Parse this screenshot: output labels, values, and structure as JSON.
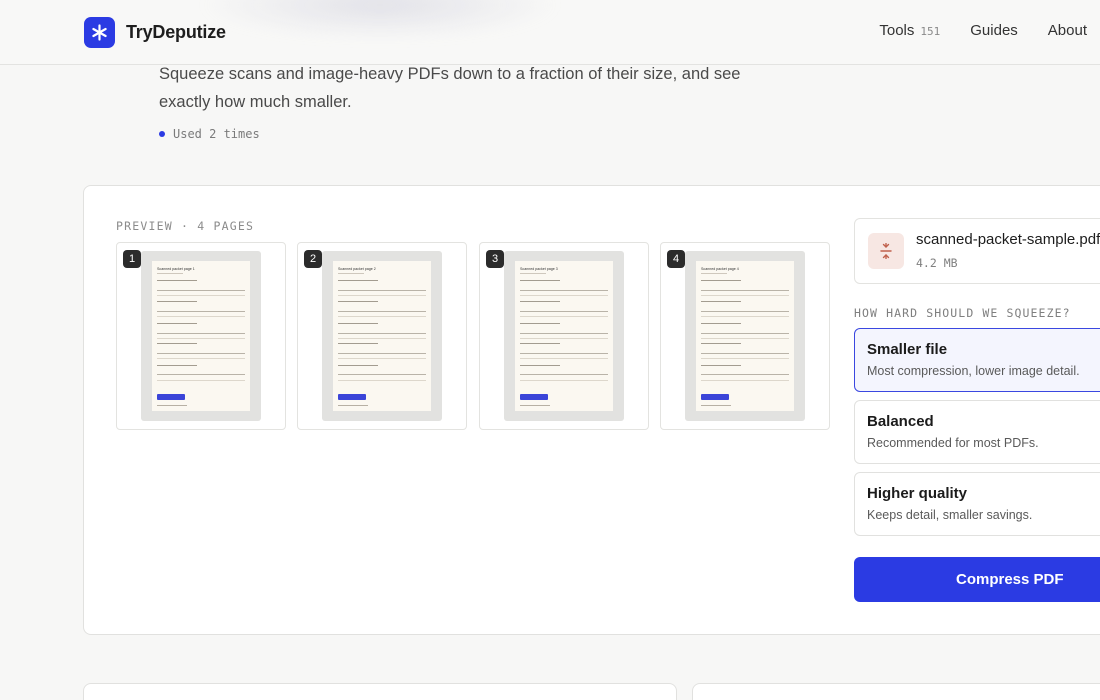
{
  "header": {
    "brand": "TryDeputize",
    "nav": [
      {
        "label": "Tools",
        "count": "151"
      },
      {
        "label": "Guides"
      },
      {
        "label": "About"
      }
    ]
  },
  "intro": {
    "description": "Squeeze scans and image-heavy PDFs down to a fraction of their size, and see exactly how much smaller.",
    "usage": "Used 2 times"
  },
  "preview": {
    "label": "PREVIEW · 4 PAGES",
    "pages": [
      {
        "number": "1",
        "title": "Scanned packet page 1"
      },
      {
        "number": "2",
        "title": "Scanned packet page 2"
      },
      {
        "number": "3",
        "title": "Scanned packet page 3"
      },
      {
        "number": "4",
        "title": "Scanned packet page 4"
      }
    ]
  },
  "file": {
    "name": "scanned-packet-sample.pdf",
    "size": "4.2 MB",
    "icon": "compress-icon"
  },
  "compression": {
    "label": "HOW HARD SHOULD WE SQUEEZE?",
    "options": [
      {
        "title": "Smaller file",
        "desc": "Most compression, lower image detail.",
        "selected": true
      },
      {
        "title": "Balanced",
        "desc": "Recommended for most PDFs.",
        "selected": false
      },
      {
        "title": "Higher quality",
        "desc": "Keeps detail, smaller savings.",
        "selected": false
      }
    ],
    "button": "Compress PDF"
  },
  "colors": {
    "accent": "#2b3be3",
    "selected_bg": "#f4f5fe"
  }
}
